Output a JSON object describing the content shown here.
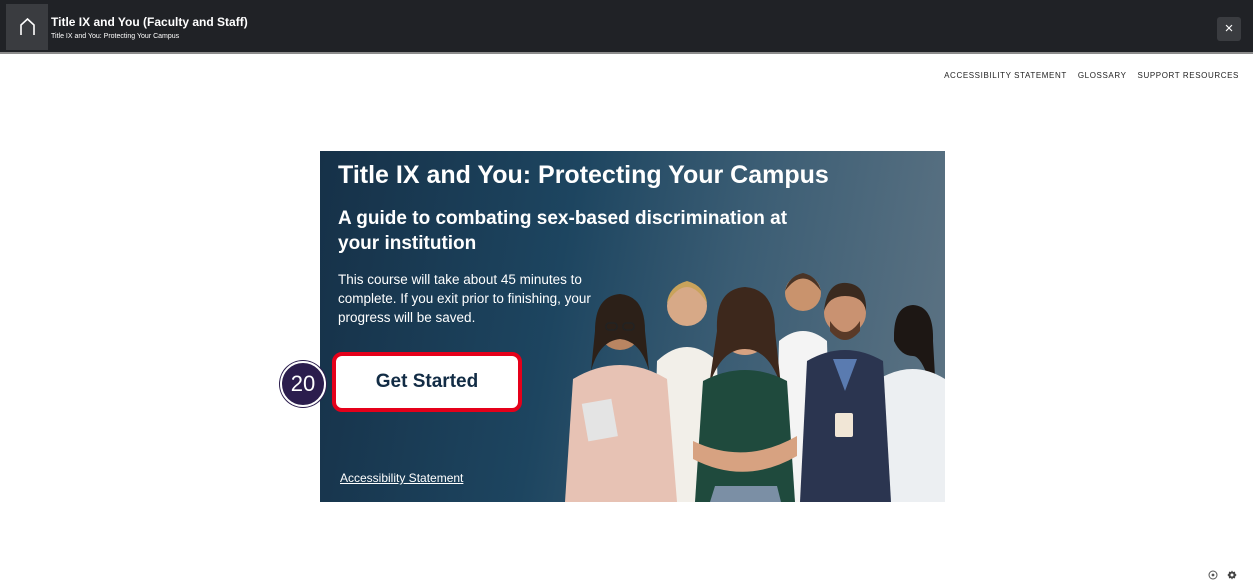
{
  "header": {
    "title": "Title IX and You (Faculty and Staff)",
    "subtitle": "Title IX and You: Protecting Your Campus",
    "home_icon": "home-icon",
    "close_label": "×"
  },
  "nav": {
    "items": [
      "ACCESSIBILITY STATEMENT",
      "GLOSSARY",
      "SUPPORT RESOURCES"
    ]
  },
  "slide": {
    "title": "Title IX and You: Protecting Your Campus",
    "subtitle": "A guide to combating sex-based discrimination at your institution",
    "body": "This course will take about 45 minutes to complete. If you exit prior to finishing, your progress will be saved.",
    "cta_label": "Get Started",
    "accessibility_link": "Accessibility Statement",
    "highlight_color": "#e5001a"
  },
  "step_badge": {
    "number": "20",
    "color": "#2b1d4d"
  },
  "footer_icons": [
    "settings-icon",
    "gear-icon"
  ]
}
